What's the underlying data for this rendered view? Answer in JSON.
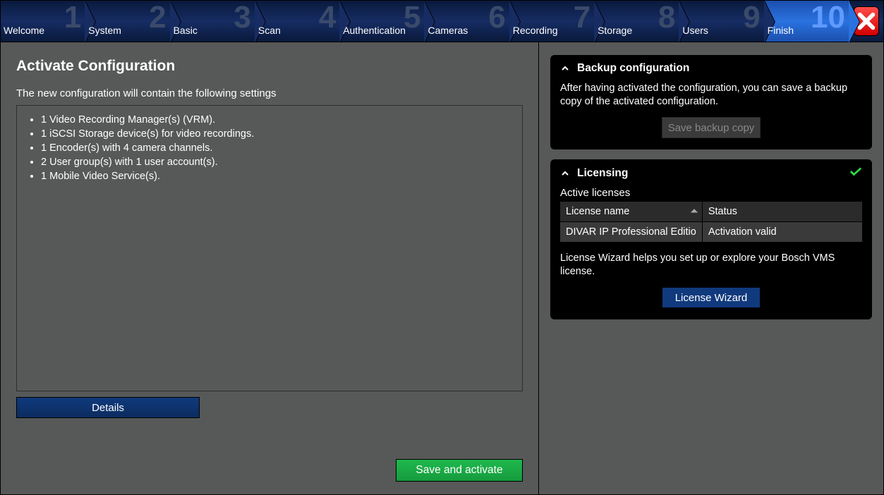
{
  "nav": {
    "steps": [
      {
        "n": "1",
        "label": "Welcome"
      },
      {
        "n": "2",
        "label": "System"
      },
      {
        "n": "3",
        "label": "Basic"
      },
      {
        "n": "4",
        "label": "Scan"
      },
      {
        "n": "5",
        "label": "Authentication"
      },
      {
        "n": "6",
        "label": "Cameras"
      },
      {
        "n": "7",
        "label": "Recording"
      },
      {
        "n": "8",
        "label": "Storage"
      },
      {
        "n": "9",
        "label": "Users"
      },
      {
        "n": "10",
        "label": "Finish"
      }
    ],
    "current_index": 9,
    "close_icon": "close-icon"
  },
  "left": {
    "title": "Activate Configuration",
    "subtitle": "The new configuration will contain the following settings",
    "items": [
      "1 Video Recording Manager(s) (VRM).",
      "1 iSCSI Storage device(s) for video recordings.",
      "1 Encoder(s) with 4 camera channels.",
      "2 User group(s) with 1 user account(s).",
      "1 Mobile Video Service(s)."
    ],
    "details_btn": "Details",
    "save_btn": "Save and activate"
  },
  "right": {
    "backup": {
      "title": "Backup configuration",
      "text": "After having activated the configuration, you can save a backup copy of the activated configuration.",
      "button": "Save backup copy",
      "button_enabled": false
    },
    "licensing": {
      "title": "Licensing",
      "status_ok": true,
      "active_heading": "Active licenses",
      "col_name": "License name",
      "col_status": "Status",
      "rows": [
        {
          "name": "DIVAR IP Professional Editio",
          "status": "Activation valid"
        }
      ],
      "help_text": "License Wizard helps you set up or explore your Bosch VMS license.",
      "wizard_btn": "License Wizard"
    }
  }
}
